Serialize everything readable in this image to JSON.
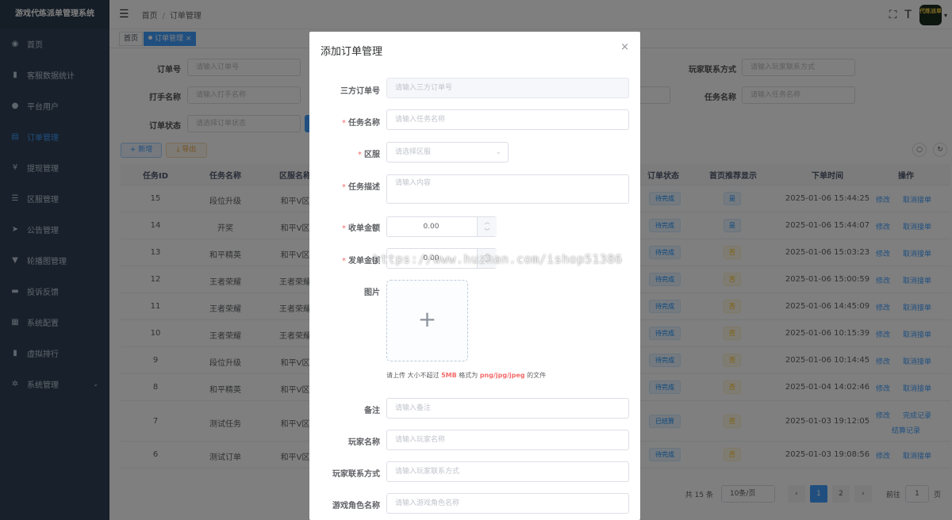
{
  "app": {
    "title": "游戏代练派单管理系统"
  },
  "sidebar": {
    "items": [
      {
        "label": "首页",
        "icon": "dashboard-icon"
      },
      {
        "label": "客服数据统计",
        "icon": "chart-icon"
      },
      {
        "label": "平台用户",
        "icon": "user-icon"
      },
      {
        "label": "订单管理",
        "icon": "order-icon",
        "active": true
      },
      {
        "label": "提现管理",
        "icon": "yen-icon"
      },
      {
        "label": "区服管理",
        "icon": "list-icon"
      },
      {
        "label": "公告管理",
        "icon": "send-icon"
      },
      {
        "label": "轮播图管理",
        "icon": "shirt-icon"
      },
      {
        "label": "投诉反馈",
        "icon": "message-icon"
      },
      {
        "label": "系统配置",
        "icon": "config-icon"
      },
      {
        "label": "虚拟排行",
        "icon": "rank-icon"
      },
      {
        "label": "系统管理",
        "icon": "gear-icon"
      }
    ]
  },
  "header": {
    "breadcrumb": [
      "首页",
      "订单管理"
    ],
    "avatar_text": "代练派单"
  },
  "tags": {
    "home": "首页",
    "current": "订单管理",
    "close": "×"
  },
  "filters": {
    "order_no_label": "订单号",
    "order_no_ph": "请输入订单号",
    "player_contact_label": "玩家联系方式",
    "player_contact_ph": "请输入玩家联系方式",
    "hitter_label": "打手名称",
    "hitter_ph": "请输入打手名称",
    "task_label": "任务名称",
    "task_ph": "请输入任务名称",
    "status_label": "订单状态",
    "status_ph": "请选择订单状态"
  },
  "toolbar": {
    "add": "+ 新增",
    "export": "⤓ 导出"
  },
  "table": {
    "headers": {
      "id": "任务ID",
      "task": "任务名称",
      "region": "区服名称",
      "status": "订单状态",
      "home": "首页推荐显示",
      "time": "下单时间",
      "op": "操作"
    },
    "rows": [
      {
        "id": "15",
        "task": "段位升级",
        "region": "和平V区",
        "status": "待完成",
        "home": "是",
        "time": "2025-01-06 15:44:25",
        "op1": "修改",
        "op2": "取消接单"
      },
      {
        "id": "14",
        "task": "开奖",
        "region": "和平V区",
        "status": "待完成",
        "home": "是",
        "time": "2025-01-06 15:44:07",
        "op1": "修改",
        "op2": "取消接单"
      },
      {
        "id": "13",
        "task": "和平精英",
        "region": "和平V区",
        "status": "待完成",
        "home": "否",
        "time": "2025-01-06 15:03:23",
        "op1": "修改",
        "op2": "取消接单"
      },
      {
        "id": "12",
        "task": "王者荣耀",
        "region": "王者荣耀",
        "status": "待完成",
        "home": "否",
        "time": "2025-01-06 15:00:59",
        "op1": "修改",
        "op2": "取消接单"
      },
      {
        "id": "11",
        "task": "王者荣耀",
        "region": "王者荣耀",
        "status": "待完成",
        "home": "否",
        "time": "2025-01-06 14:45:09",
        "op1": "修改",
        "op2": "取消接单"
      },
      {
        "id": "10",
        "task": "王者荣耀",
        "region": "王者荣耀",
        "status": "待完成",
        "home": "否",
        "time": "2025-01-06 10:15:39",
        "op1": "修改",
        "op2": "取消接单"
      },
      {
        "id": "9",
        "task": "段位升级",
        "region": "和平V区",
        "status": "待完成",
        "home": "否",
        "time": "2025-01-06 10:14:45",
        "op1": "修改",
        "op2": "取消接单"
      },
      {
        "id": "8",
        "task": "和平精英",
        "region": "和平V区",
        "status": "待完成",
        "home": "否",
        "time": "2025-01-04 14:02:46",
        "op1": "修改",
        "op2": "取消接单"
      },
      {
        "id": "7",
        "task": "测试任务",
        "region": "和平V区",
        "status": "已结算",
        "home": "否",
        "time": "2025-01-03 19:12:05",
        "op1": "修改",
        "op2": "完成记录",
        "op3": "结算记录"
      },
      {
        "id": "6",
        "task": "测试订单",
        "region": "和平V区",
        "status": "待完成",
        "home": "否",
        "time": "2025-01-03 19:08:56",
        "op1": "修改",
        "op2": "取消接单"
      }
    ]
  },
  "pager": {
    "total": "共 15 条",
    "size": "10条/页",
    "prev": "‹",
    "p1": "1",
    "p2": "2",
    "next": "›",
    "goto": "前往",
    "page_input": "1",
    "page_unit": "页"
  },
  "dialog": {
    "title": "添加订单管理",
    "close": "×",
    "fields": {
      "third_label": "三方订单号",
      "third_ph": "请输入三方订单号",
      "task_label": "任务名称",
      "task_ph": "请输入任务名称",
      "region_label": "区服",
      "region_ph": "请选择区服",
      "desc_label": "任务描述",
      "desc_ph": "请输入内容",
      "recv_label": "收单金额",
      "recv_value": "0.00",
      "send_label": "发单金额",
      "send_value": "0.00",
      "image_label": "图片",
      "upload_tip_pre": "请上传 大小不超过 ",
      "upload_tip_size": "5MB",
      "upload_tip_mid": " 格式为 ",
      "upload_tip_fmt": "png/jpg/jpeg",
      "upload_tip_post": " 的文件",
      "remark_label": "备注",
      "remark_ph": "请输入备注",
      "player_label": "玩家名称",
      "player_ph": "请输入玩家名称",
      "contact_label": "玩家联系方式",
      "contact_ph": "请输入玩家联系方式",
      "role_label": "游戏角色名称",
      "role_ph": "请输入游戏角色名称"
    },
    "req": "*"
  },
  "watermark": "https://www.huzhan.com/ishop51386"
}
